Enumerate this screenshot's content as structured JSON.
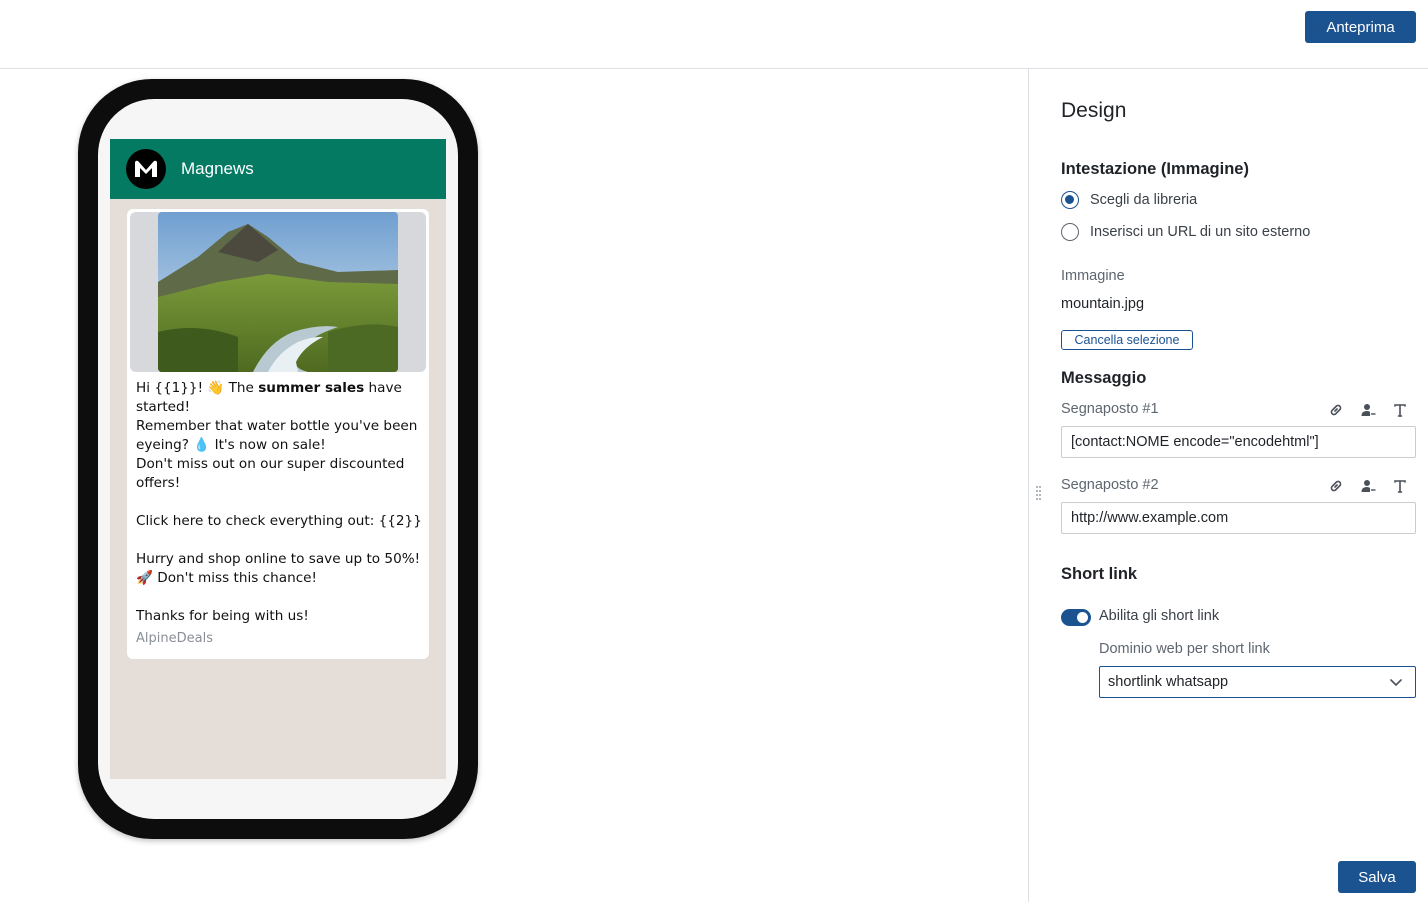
{
  "toolbar": {
    "preview_label": "Anteprima"
  },
  "phone": {
    "sender_name": "Magnews",
    "message_lines": [
      "Hi {{1}}! 👋 The ",
      "started!",
      "Remember that water bottle you've been",
      "eyeing? 💧 It's now on sale!",
      "Don't miss out on our super discounted",
      "offers!",
      "",
      "Click here to check everything out: {{2}}",
      "",
      "Hurry and shop online to save up to 50%!",
      "🚀 Don't miss this chance!",
      "",
      "Thanks for being with us!"
    ],
    "message_bold": "summer sales",
    "message_after_bold": " have",
    "footer": "AlpineDeals"
  },
  "panel": {
    "title": "Design",
    "header_section": {
      "title": "Intestazione (Immagine)",
      "options": [
        "Scegli da libreria",
        "Inserisci un URL di un sito esterno"
      ],
      "selected": "Scegli da libreria",
      "image_label": "Immagine",
      "image_value": "mountain.jpg",
      "clear_label": "Cancella selezione"
    },
    "message_section": {
      "title": "Messaggio",
      "placeholders": [
        {
          "label": "Segnaposto #1",
          "value": "[contact:NOME encode=\"encodehtml\"]"
        },
        {
          "label": "Segnaposto #2",
          "value": "http://www.example.com"
        }
      ],
      "icons": [
        "link-icon",
        "add-contact-icon",
        "text-format-icon"
      ]
    },
    "shortlink_section": {
      "title": "Short link",
      "toggle_label": "Abilita gli short link",
      "toggle_on": true,
      "domain_label": "Dominio web per short link",
      "domain_value": "shortlink whatsapp"
    },
    "save_label": "Salva"
  },
  "colors": {
    "brand": "#1b5391",
    "whatsapp_header": "#047a62",
    "chat_bg": "#e5ddd7"
  }
}
